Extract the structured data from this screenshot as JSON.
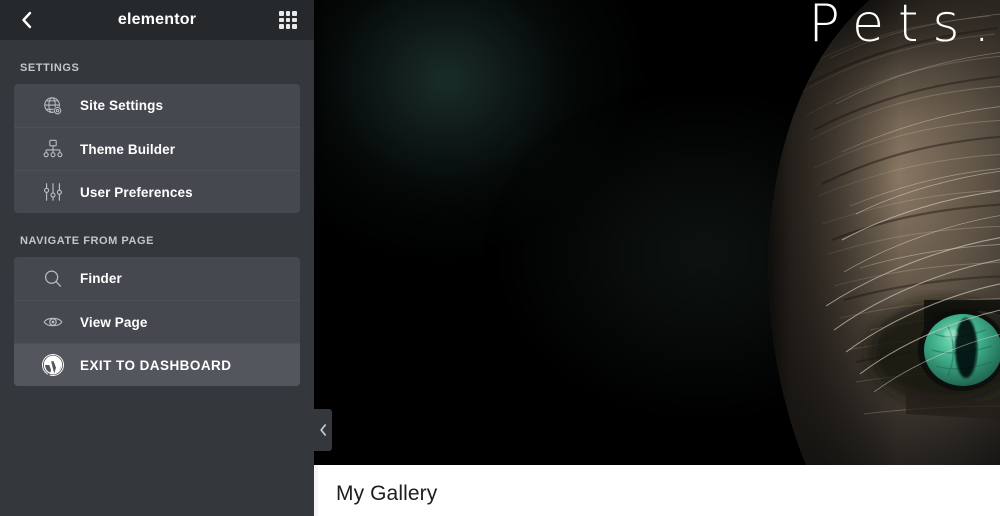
{
  "panel": {
    "title": "elementor",
    "back_icon": "chevron-left-icon",
    "apps_icon": "apps-grid-icon",
    "sections": [
      {
        "label": "SETTINGS",
        "items": [
          {
            "label": "Site Settings",
            "icon": "globe-settings-icon",
            "active": false
          },
          {
            "label": "Theme Builder",
            "icon": "sitemap-icon",
            "active": false
          },
          {
            "label": "User Preferences",
            "icon": "sliders-icon",
            "active": false
          }
        ]
      },
      {
        "label": "NAVIGATE FROM PAGE",
        "items": [
          {
            "label": "Finder",
            "icon": "search-icon",
            "active": false
          },
          {
            "label": "View Page",
            "icon": "eye-icon",
            "active": false
          },
          {
            "label": "EXIT TO DASHBOARD",
            "icon": "wordpress-icon",
            "active": true
          }
        ]
      }
    ],
    "collapse_icon": "chevron-left-icon"
  },
  "preview": {
    "hero": {
      "title": "Pets.",
      "image_alt": "close-up of a tabby cat with a green eye"
    },
    "gallery": {
      "heading": "My Gallery"
    }
  },
  "colors": {
    "sidebar_bg": "#34383d",
    "header_bg": "#26292c",
    "card_bg": "#45484e",
    "card_active_bg": "#53565c",
    "text": "#ffffff",
    "muted_text": "#c3c6c9",
    "hero_bg": "#000000",
    "eye_green": "#3fae8a"
  }
}
